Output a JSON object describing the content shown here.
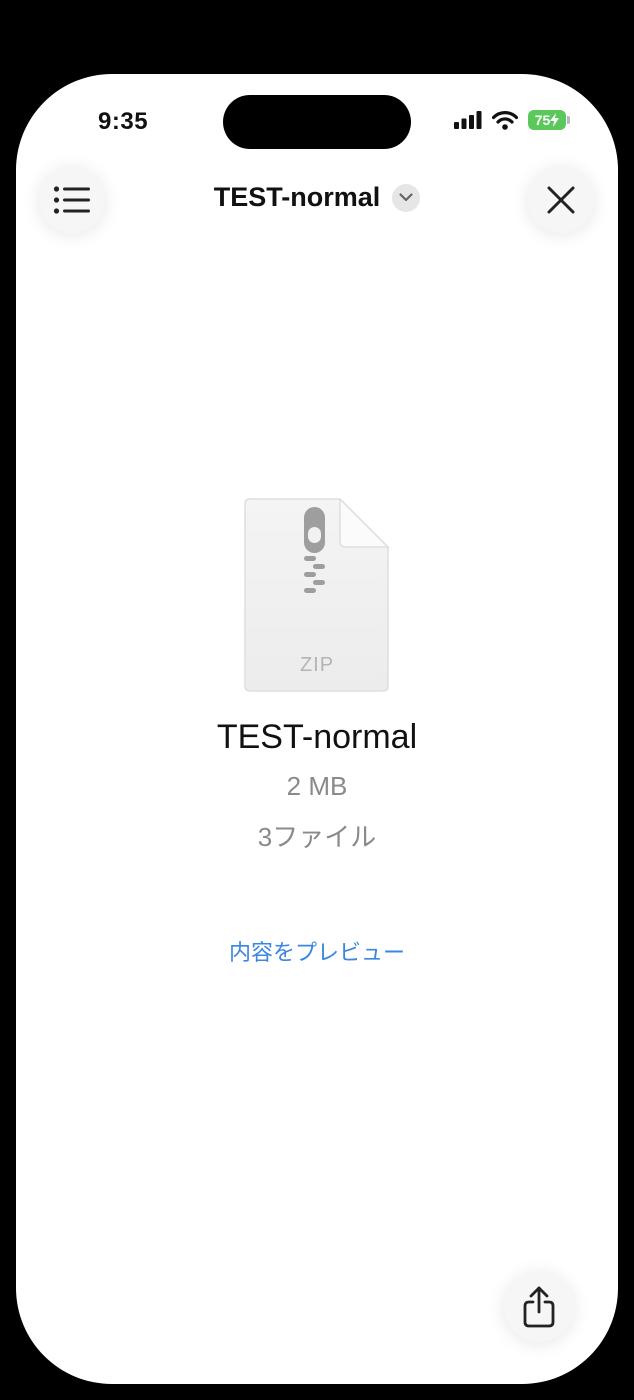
{
  "status_bar": {
    "time": "9:35",
    "battery": "75"
  },
  "header": {
    "title": "TEST-normal"
  },
  "file": {
    "type_label": "ZIP",
    "name": "TEST-normal",
    "size": "2 MB",
    "count": "3ファイル"
  },
  "actions": {
    "preview_label": "内容をプレビュー"
  },
  "colors": {
    "accent": "#3a86e0",
    "battery": "#5ac85a"
  }
}
